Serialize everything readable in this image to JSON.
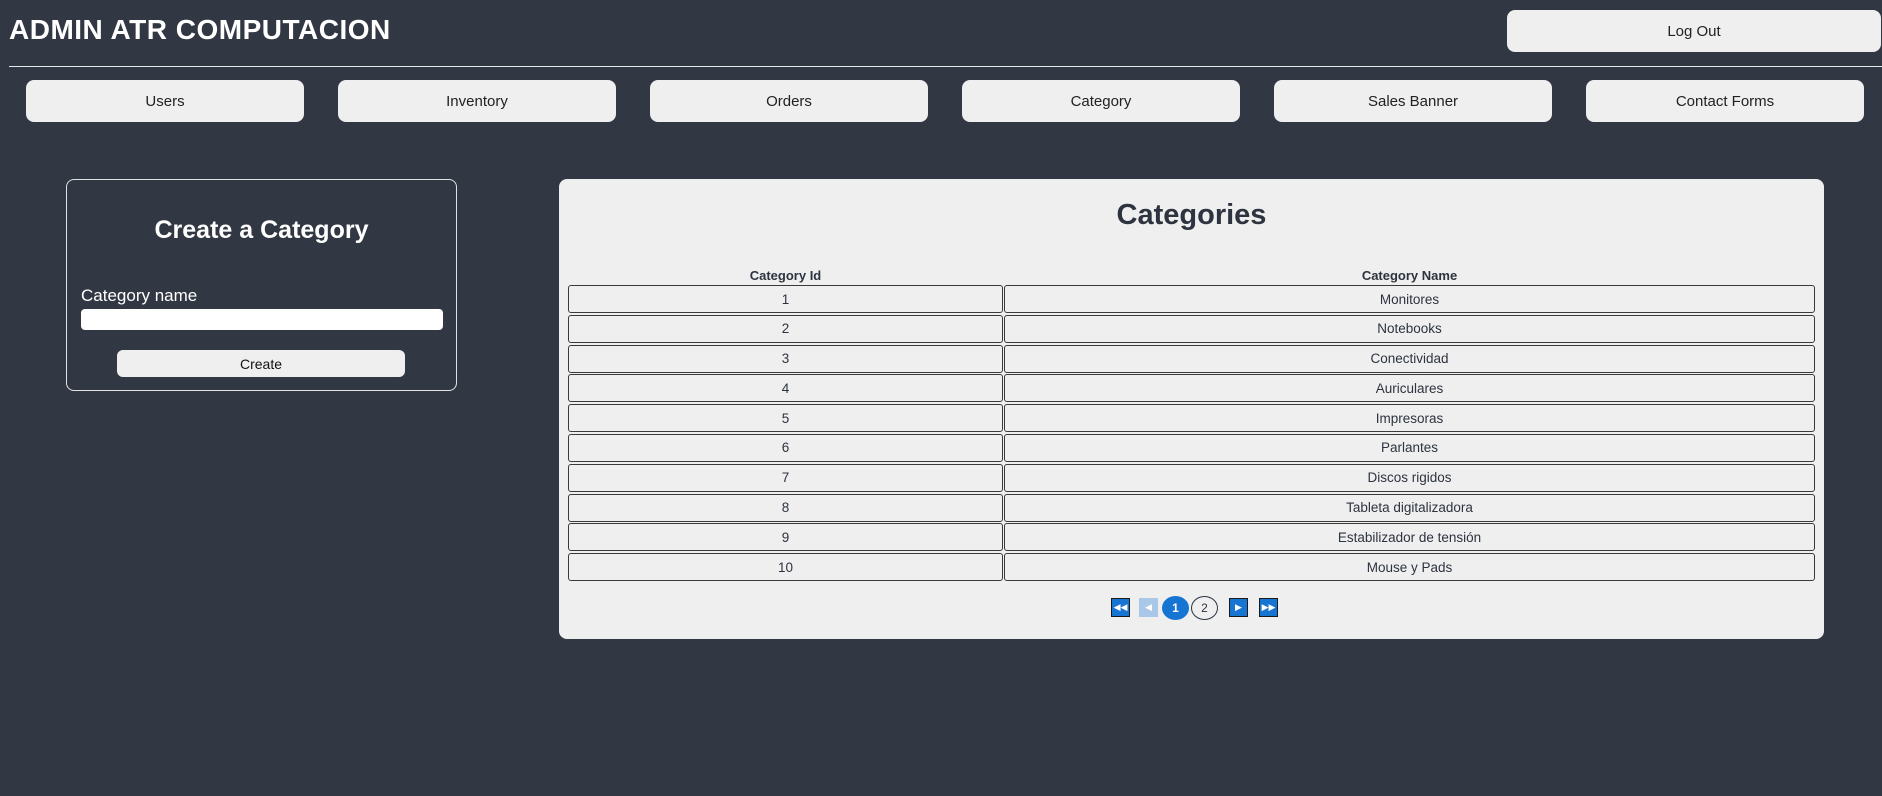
{
  "header": {
    "brand": "ADMIN ATR COMPUTACION",
    "logout_label": "Log Out"
  },
  "nav": {
    "items": [
      {
        "label": "Users"
      },
      {
        "label": "Inventory"
      },
      {
        "label": "Orders"
      },
      {
        "label": "Category"
      },
      {
        "label": "Sales Banner"
      },
      {
        "label": "Contact Forms"
      }
    ]
  },
  "create_form": {
    "title": "Create a Category",
    "field_label": "Category name",
    "field_value": "",
    "button_label": "Create"
  },
  "categories": {
    "title": "Categories",
    "columns": [
      "Category Id",
      "Category Name"
    ],
    "rows": [
      {
        "id": "1",
        "name": "Monitores"
      },
      {
        "id": "2",
        "name": "Notebooks"
      },
      {
        "id": "3",
        "name": "Conectividad"
      },
      {
        "id": "4",
        "name": "Auriculares"
      },
      {
        "id": "5",
        "name": "Impresoras"
      },
      {
        "id": "6",
        "name": "Parlantes"
      },
      {
        "id": "7",
        "name": "Discos rigidos"
      },
      {
        "id": "8",
        "name": "Tableta digitalizadora"
      },
      {
        "id": "9",
        "name": "Estabilizador de tensión"
      },
      {
        "id": "10",
        "name": "Mouse y Pads"
      }
    ]
  },
  "pagination": {
    "pages": [
      "1",
      "2"
    ],
    "current": "1",
    "icons": {
      "first": "double-left-arrow-icon",
      "prev": "left-arrow-icon",
      "next": "right-arrow-icon",
      "last": "double-right-arrow-icon"
    }
  },
  "colors": {
    "background": "#323843",
    "surface": "#efefef",
    "accent": "#1674d2"
  }
}
